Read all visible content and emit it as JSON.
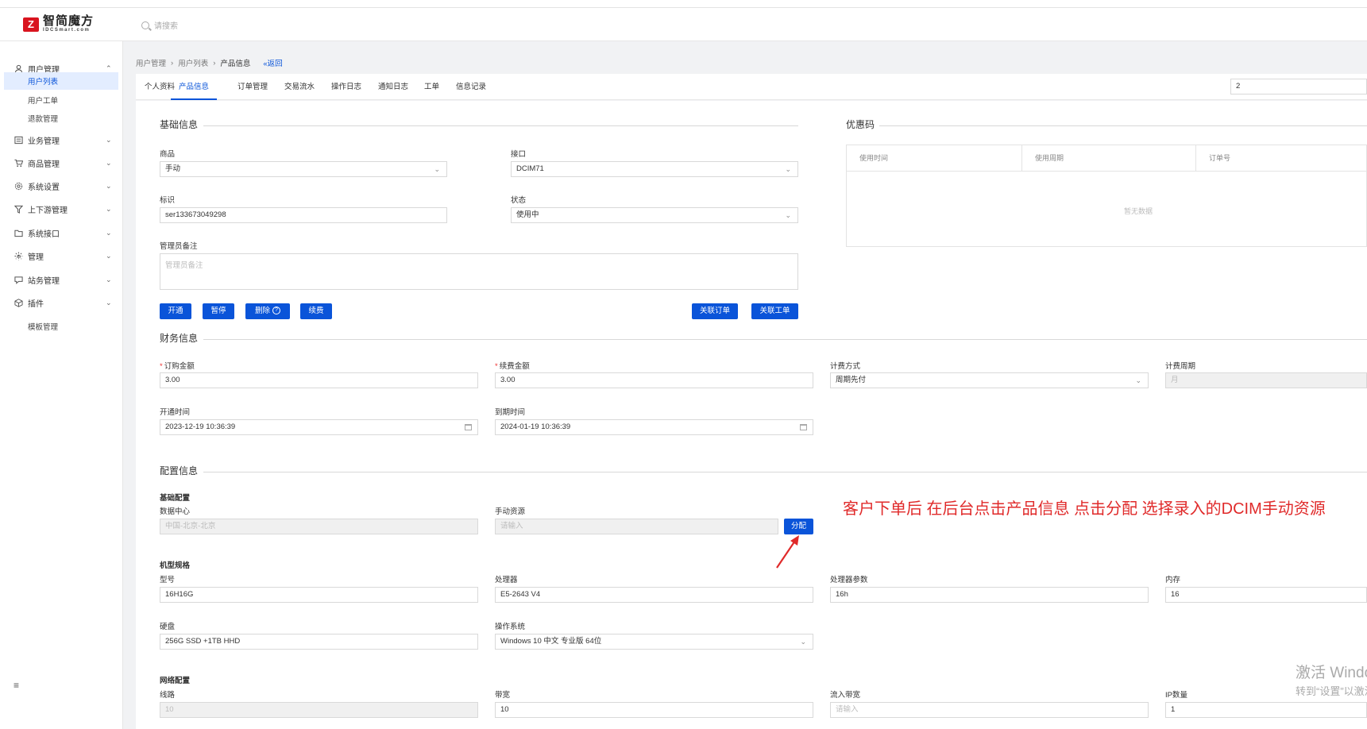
{
  "brand": {
    "name_cn": "智简魔方",
    "name_en": "IDCSmart.com",
    "logo_glyph": "Z"
  },
  "search": {
    "placeholder": "请搜索"
  },
  "sidebar": {
    "items": [
      {
        "label": "用户管理",
        "icon": "user-icon",
        "chevron": "⌃"
      },
      {
        "label": "业务管理",
        "icon": "list-icon",
        "chevron": "⌄"
      },
      {
        "label": "商品管理",
        "icon": "cart-icon",
        "chevron": "⌄"
      },
      {
        "label": "系统设置",
        "icon": "gear-icon",
        "chevron": "⌄"
      },
      {
        "label": "上下游管理",
        "icon": "filter-icon",
        "chevron": "⌄"
      },
      {
        "label": "系统接口",
        "icon": "folder-icon",
        "chevron": "⌄"
      },
      {
        "label": "管理",
        "icon": "sparkle-icon",
        "chevron": "⌄"
      },
      {
        "label": "站务管理",
        "icon": "site-icon",
        "chevron": "⌄"
      },
      {
        "label": "插件",
        "icon": "cube-icon",
        "chevron": "⌄"
      }
    ],
    "user_sub": [
      {
        "label": "用户列表",
        "active": true
      },
      {
        "label": "用户工单",
        "active": false
      },
      {
        "label": "退款管理",
        "active": false
      }
    ],
    "plugin_sub": [
      {
        "label": "模板管理"
      }
    ],
    "footer_icon": "≡"
  },
  "breadcrumb": {
    "items": [
      "用户管理",
      "用户列表",
      "产品信息"
    ],
    "separator": "›",
    "back": "«返回"
  },
  "tabs": {
    "items": [
      "个人资料",
      "产品信息",
      "订单管理",
      "交易流水",
      "操作日志",
      "通知日志",
      "工单",
      "信息记录"
    ],
    "active_index": 1,
    "selector_value": "2"
  },
  "basic": {
    "title": "基础信息",
    "product_label": "商品",
    "product_value": "手动",
    "interface_label": "接口",
    "interface_value": "DCIM71",
    "ident_label": "标识",
    "ident_value": "ser133673049298",
    "status_label": "状态",
    "status_value": "使用中",
    "remark_label": "管理员备注",
    "remark_placeholder": "管理员备注",
    "buttons": {
      "open": "开通",
      "pause": "暂停",
      "delete": "删除",
      "renew": "续费",
      "link_order": "关联订单",
      "link_ticket": "关联工单"
    },
    "delete_q": "?"
  },
  "coupon": {
    "title": "优惠码",
    "columns": [
      "使用时间",
      "使用周期",
      "订单号"
    ],
    "empty": "暂无数据"
  },
  "finance": {
    "title": "财务信息",
    "order_amount_label": "订购金额",
    "order_amount_value": "3.00",
    "renew_amount_label": "续费金额",
    "renew_amount_value": "3.00",
    "billing_label": "计费方式",
    "billing_value": "周期先付",
    "cycle_label": "计费周期",
    "cycle_value": "月",
    "open_time_label": "开通时间",
    "open_time_value": "2023-12-19 10:36:39",
    "expire_label": "到期时间",
    "expire_value": "2024-01-19 10:36:39",
    "required_mark": "*"
  },
  "config": {
    "title": "配置信息",
    "basic_sub": "基础配置",
    "dc_label": "数据中心",
    "dc_value": "中国-北京-北京",
    "manual_label": "手动资源",
    "manual_placeholder": "请输入",
    "assign_button": "分配",
    "spec_sub": "机型规格",
    "model_label": "型号",
    "model_value": "16H16G",
    "cpu_label": "处理器",
    "cpu_value": "E5-2643 V4",
    "cpu_param_label": "处理器参数",
    "cpu_param_value": "16h",
    "mem_label": "内存",
    "mem_value": "16",
    "disk_label": "硬盘",
    "disk_value": "256G SSD +1TB HHD",
    "os_label": "操作系统",
    "os_value": "Windows 10 中文 专业版 64位",
    "net_sub": "网络配置",
    "line_label": "线路",
    "line_value": "10",
    "bw_label": "带宽",
    "bw_value": "10",
    "in_bw_label": "流入带宽",
    "in_bw_placeholder": "请输入",
    "ip_label": "IP数量",
    "ip_value": "1"
  },
  "annotation": {
    "text": "客户下单后  在后台点击产品信息  点击分配 选择录入的DCIM手动资源"
  },
  "watermark": {
    "line1": "激活 Windows",
    "line2": "转到“设置”以激活 Windows。"
  },
  "colors": {
    "primary": "#0a54d9",
    "annotation": "#e02a2a",
    "brand": "#d9141f"
  }
}
